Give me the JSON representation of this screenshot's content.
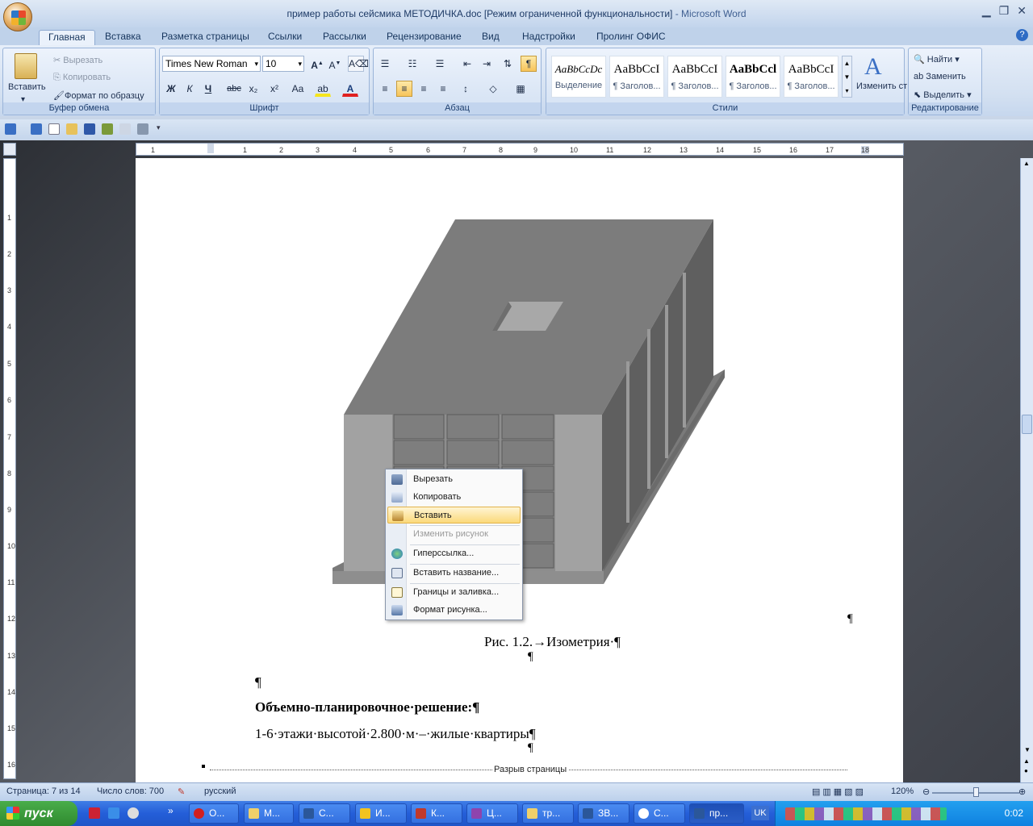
{
  "window": {
    "title": "пример работы сейсмика МЕТОДИЧКА.doc [Режим ограниченной функциональности]",
    "app_suffix": " - Microsoft Word"
  },
  "ribbon_tabs": [
    "Главная",
    "Вставка",
    "Разметка страницы",
    "Ссылки",
    "Рассылки",
    "Рецензирование",
    "Вид",
    "Надстройки",
    "Пролинг ОФИС"
  ],
  "clipboard": {
    "label": "Буфер обмена",
    "paste": "Вставить",
    "cut": "Вырезать",
    "copy": "Копировать",
    "format_painter": "Формат по образцу"
  },
  "font": {
    "label": "Шрифт",
    "name": "Times New Roman",
    "size": "10",
    "bold": "Ж",
    "italic": "К",
    "underline": "Ч",
    "strike": "abc",
    "sub": "x₂",
    "sup": "x²",
    "case": "Aa"
  },
  "paragraph": {
    "label": "Абзац"
  },
  "styles": {
    "label": "Стили",
    "items": [
      {
        "sample": "AaBbCcDc",
        "name": "Выделение"
      },
      {
        "sample": "AaBbCcI",
        "name": "¶ Заголов..."
      },
      {
        "sample": "AaBbCcI",
        "name": "¶ Заголов..."
      },
      {
        "sample": "AaBbCcl",
        "name": "¶ Заголов..."
      },
      {
        "sample": "AaBbCcI",
        "name": "¶ Заголов..."
      }
    ],
    "change": "Изменить стили"
  },
  "editing": {
    "label": "Редактирование",
    "find": "Найти",
    "replace": "Заменить",
    "select": "Выделить"
  },
  "ruler": {
    "h_ticks": [
      "1",
      "1",
      "2",
      "3",
      "4",
      "5",
      "6",
      "7",
      "8",
      "9",
      "10",
      "11",
      "12",
      "13",
      "14",
      "15",
      "16",
      "17",
      "18"
    ],
    "v_ticks": [
      "1",
      "2",
      "3",
      "4",
      "5",
      "6",
      "7",
      "8",
      "9",
      "10",
      "11",
      "12",
      "13",
      "14",
      "15",
      "16"
    ]
  },
  "document": {
    "caption": "Рис. 1.2.→Изометрия·¶",
    "pilcrow": "¶",
    "heading": "Объемно-планировочное·решение:¶",
    "body1": "1-6·этажи·высотой·2.800·м·–·жилые·квартиры¶",
    "page_break": "Разрыв страницы"
  },
  "context_menu": {
    "items": [
      {
        "label": "Вырезать",
        "state": "normal"
      },
      {
        "label": "Копировать",
        "state": "normal"
      },
      {
        "label": "Вставить",
        "state": "hover"
      },
      {
        "label": "Изменить рисунок",
        "state": "disabled"
      },
      {
        "label": "Гиперссылка...",
        "state": "normal"
      },
      {
        "label": "Вставить название...",
        "state": "normal"
      },
      {
        "label": "Границы и заливка...",
        "state": "normal"
      },
      {
        "label": "Формат рисунка...",
        "state": "normal"
      }
    ]
  },
  "status": {
    "page": "Страница: 7 из 14",
    "words": "Число слов: 700",
    "lang": "русский",
    "zoom": "120%"
  },
  "taskbar": {
    "start": "пуск",
    "buttons": [
      "О...",
      "М...",
      "С...",
      "И...",
      "К...",
      "Ц...",
      "тр...",
      "ЗВ...",
      "С...",
      "пр..."
    ],
    "lang": "UK",
    "clock": "0:02"
  },
  "colors": {
    "accent": "#2b579a",
    "hover": "#fbd97a"
  }
}
